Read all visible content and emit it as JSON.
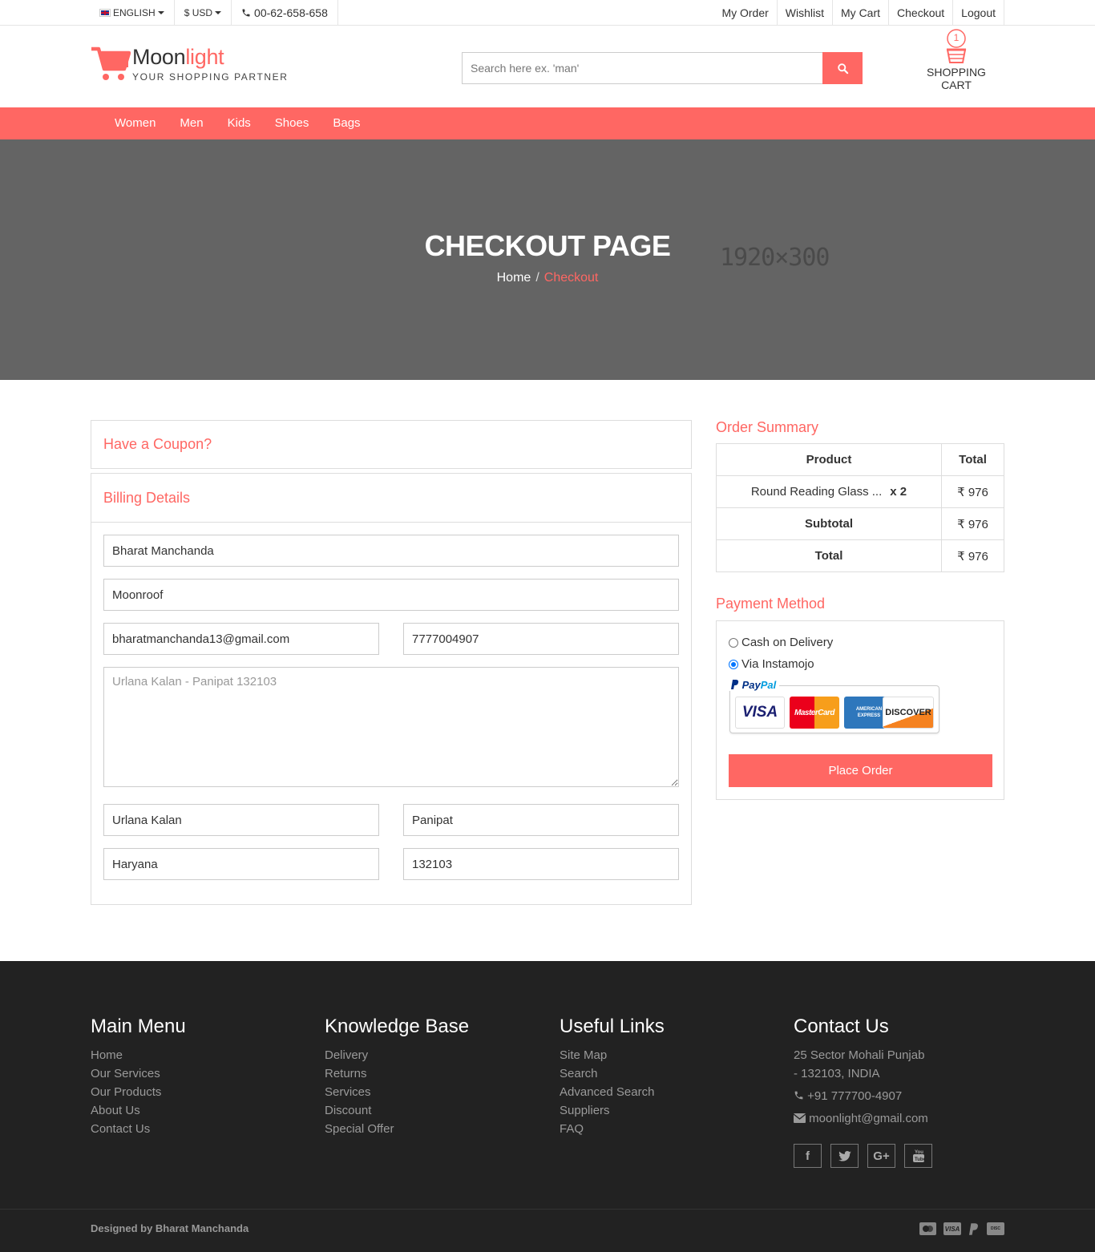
{
  "topbar": {
    "language": "ENGLISH",
    "currency": "$ USD",
    "phone": "00-62-658-658",
    "links": [
      "My Order",
      "Wishlist",
      "My Cart",
      "Checkout",
      "Logout"
    ]
  },
  "header": {
    "logo_main": "Moon",
    "logo_accent": "light",
    "tagline": "YOUR SHOPPING PARTNER",
    "search_placeholder": "Search here ex. 'man'",
    "cart_count": "1",
    "cart_label": "SHOPPING CART"
  },
  "nav": [
    "Women",
    "Men",
    "Kids",
    "Shoes",
    "Bags"
  ],
  "banner": {
    "title": "CHECKOUT PAGE",
    "placeholder_text": "1920×300",
    "breadcrumb_home": "Home",
    "breadcrumb_sep": "/",
    "breadcrumb_current": "Checkout"
  },
  "coupon": {
    "title": "Have a Coupon?"
  },
  "billing": {
    "title": "Billing Details",
    "name": "Bharat Manchanda",
    "company": "Moonroof",
    "email": "bharatmanchanda13@gmail.com",
    "phone": "7777004907",
    "address_placeholder": "Urlana Kalan - Panipat 132103",
    "town": "Urlana Kalan",
    "city": "Panipat",
    "state": "Haryana",
    "zip": "132103"
  },
  "order_summary": {
    "title": "Order Summary",
    "col_product": "Product",
    "col_total": "Total",
    "item_name": "Round Reading Glass ...",
    "item_qty": "x 2",
    "item_total": "₹ 976",
    "subtotal_label": "Subtotal",
    "subtotal_value": "₹ 976",
    "total_label": "Total",
    "total_value": "₹ 976"
  },
  "payment": {
    "title": "Payment Method",
    "option_cod": "Cash on Delivery",
    "option_instamojo": "Via Instamojo",
    "selected": "Via Instamojo",
    "paypal_a": "Pay",
    "paypal_b": "Pal",
    "cards": [
      "VISA",
      "MasterCard",
      "AMERICAN EXPRESS",
      "DISCOVER"
    ],
    "place_order": "Place Order"
  },
  "footer": {
    "main_menu": {
      "title": "Main Menu",
      "links": [
        "Home",
        "Our Services",
        "Our Products",
        "About Us",
        "Contact Us"
      ]
    },
    "knowledge_base": {
      "title": "Knowledge Base",
      "links": [
        "Delivery",
        "Returns",
        "Services",
        "Discount",
        "Special Offer"
      ]
    },
    "useful_links": {
      "title": "Useful Links",
      "links": [
        "Site Map",
        "Search",
        "Advanced Search",
        "Suppliers",
        "FAQ"
      ]
    },
    "contact": {
      "title": "Contact Us",
      "address_1": "25 Sector Mohali Punjab",
      "address_2": "- 132103, INDIA",
      "phone": "+91 777700-4907",
      "email": "moonlight@gmail.com"
    },
    "social": [
      "facebook-icon",
      "twitter-icon",
      "google-plus-icon",
      "youtube-icon"
    ],
    "credit": "Designed by Bharat Manchanda",
    "payment_icons": [
      "mastercard-icon",
      "visa-icon",
      "paypal-icon",
      "discover-icon"
    ]
  },
  "colors": {
    "accent": "#ff6763",
    "banner_bg": "#646464",
    "footer_bg": "#222222"
  }
}
